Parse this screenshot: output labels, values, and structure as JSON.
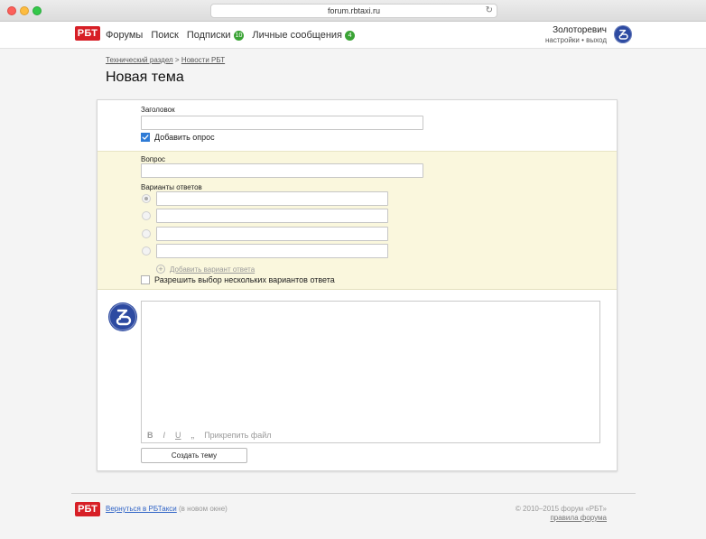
{
  "browser": {
    "url": "forum.rbtaxi.ru",
    "reload_icon": "↻"
  },
  "header": {
    "logo_text": "РБТ",
    "nav": [
      {
        "label": "Форумы"
      },
      {
        "label": "Поиск"
      },
      {
        "label": "Подписки",
        "badge": "10"
      },
      {
        "label": "Личные сообщения",
        "badge": "4"
      }
    ],
    "user": {
      "name": "Золоторевич",
      "settings_link": "настройки",
      "separator": " • ",
      "logout_link": "выход"
    }
  },
  "breadcrumb": {
    "items": [
      "Технический раздел",
      "Новости РБТ"
    ],
    "separator": " > "
  },
  "page_title": "Новая тема",
  "form": {
    "title_label": "Заголовок",
    "title_value": "",
    "add_poll_label": "Добавить опрос",
    "add_poll_checked": true,
    "poll": {
      "question_label": "Вопрос",
      "question_value": "",
      "options_label": "Варианты ответов",
      "options": [
        "",
        "",
        "",
        ""
      ],
      "add_option_label": "Добавить вариант ответа",
      "multiple_label": "Разрешить выбор нескольких вариантов ответа",
      "multiple_checked": false
    },
    "message_value": "",
    "toolbar": {
      "bold": "B",
      "italic": "I",
      "underline": "U",
      "quote": "„",
      "attach": "Прикрепить файл"
    },
    "submit_label": "Создать тему"
  },
  "footer": {
    "logo_text": "РБТ",
    "back_link": "Вернуться в РБТакси",
    "back_note": "(в новом окне)",
    "copyright": "© 2010–2015 форум «РБТ»",
    "rules_link": "правила форума"
  },
  "colors": {
    "brand_red": "#d71f26",
    "badge_green": "#3aa335",
    "avatar_blue": "#2d4aa1",
    "poll_bg": "#faf7dd",
    "checkbox_blue": "#2f7bd6"
  }
}
